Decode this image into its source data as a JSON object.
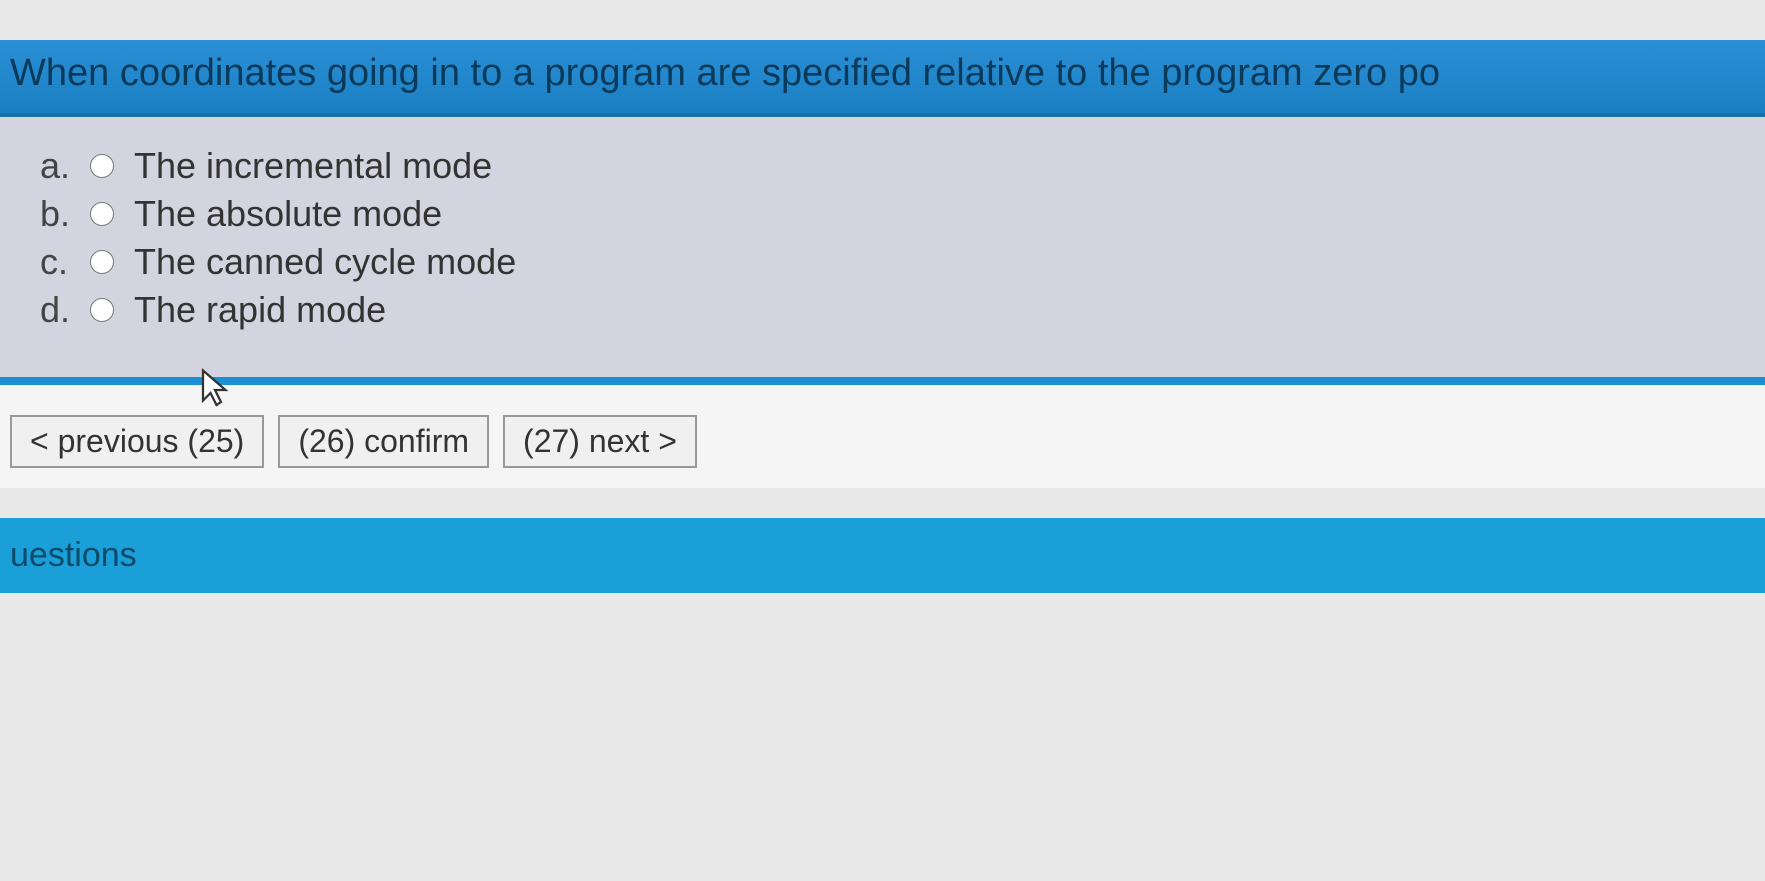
{
  "question": {
    "text": "When coordinates going in to a program are specified relative to the program zero po"
  },
  "answers": [
    {
      "letter": "a.",
      "text": "The incremental mode"
    },
    {
      "letter": "b.",
      "text": "The absolute mode"
    },
    {
      "letter": "c.",
      "text": "The canned cycle mode"
    },
    {
      "letter": "d.",
      "text": "The rapid mode"
    }
  ],
  "nav": {
    "previous": "< previous (25)",
    "confirm": "(26) confirm",
    "next": "(27) next >"
  },
  "footer": {
    "label": "uestions"
  }
}
